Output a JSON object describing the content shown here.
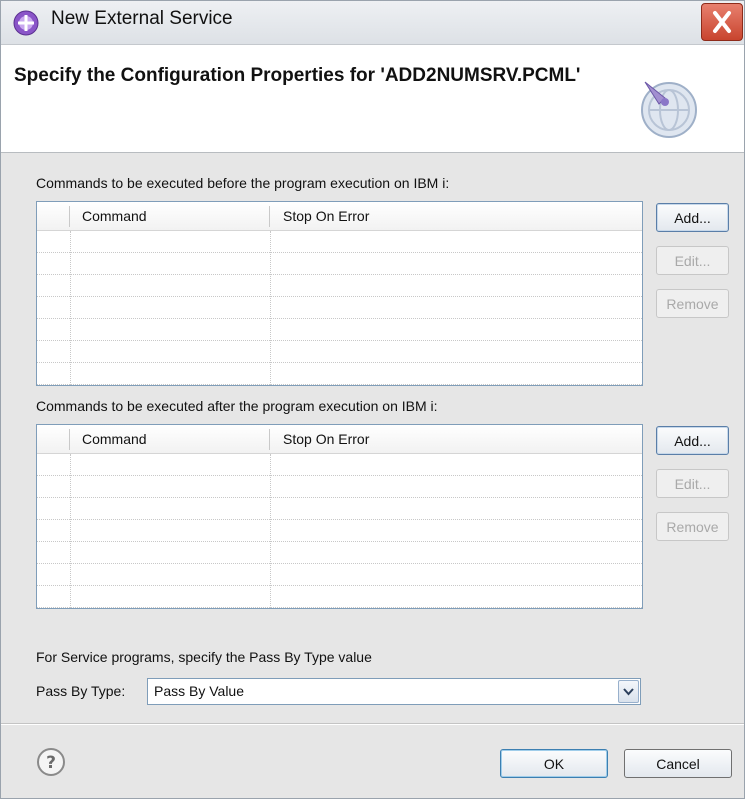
{
  "window": {
    "title": "New External Service",
    "title_icon": "plugin-icon",
    "close_icon": "close-icon"
  },
  "banner": {
    "title": "Specify the Configuration Properties for 'ADD2NUMSRV.PCML'",
    "icon": "wizard-globe-icon"
  },
  "before_section": {
    "label": "Commands to be executed before the program execution on IBM i:",
    "columns": [
      "",
      "Command",
      "Stop On Error"
    ],
    "rows": [],
    "buttons": {
      "add": "Add...",
      "edit": "Edit...",
      "remove": "Remove"
    }
  },
  "after_section": {
    "label": "Commands to be executed after the program execution on IBM i:",
    "columns": [
      "",
      "Command",
      "Stop On Error"
    ],
    "rows": [],
    "buttons": {
      "add": "Add...",
      "edit": "Edit...",
      "remove": "Remove"
    }
  },
  "pass_by": {
    "description": "For Service programs, specify the Pass By Type value",
    "label": "Pass By Type:",
    "value": "Pass By Value"
  },
  "footer": {
    "help_icon": "help-icon",
    "ok": "OK",
    "cancel": "Cancel"
  },
  "colors": {
    "dialog_bg": "#e6e6e6",
    "table_border": "#7f9db9",
    "button_border": "#5a7ea8",
    "close_button": "#c8442e",
    "disabled_text": "#a9a9a9"
  }
}
